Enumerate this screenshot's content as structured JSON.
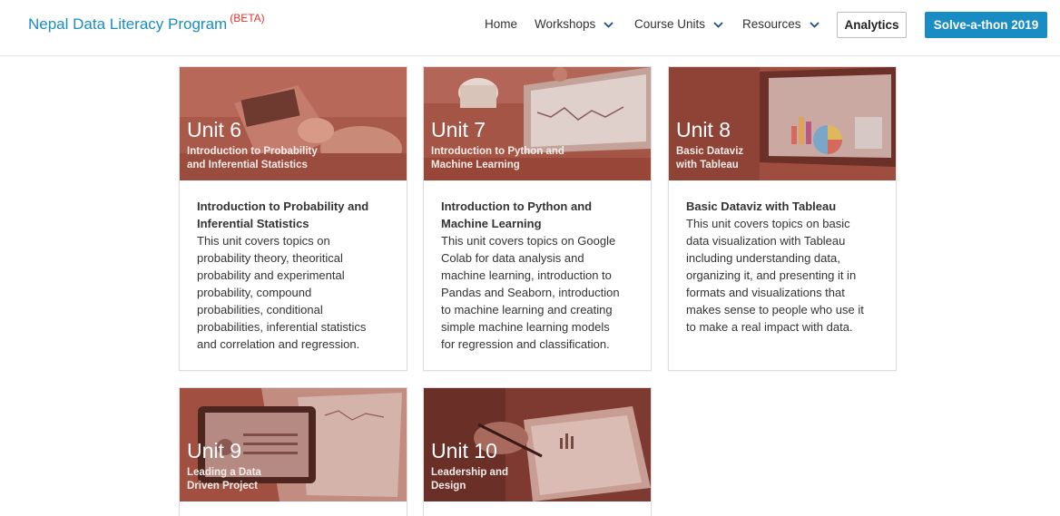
{
  "brand": {
    "name": "Nepal Data Literacy Program",
    "tag": "(BETA)",
    "color": "#1a8cc4",
    "tag_color": "#e3352f"
  },
  "nav": {
    "items": [
      {
        "label": "Home",
        "dropdown": false
      },
      {
        "label": "Workshops",
        "dropdown": true
      },
      {
        "label": "Course Units",
        "dropdown": true
      },
      {
        "label": "Resources",
        "dropdown": true
      }
    ],
    "analytics_label": "Analytics",
    "solve_label": "Solve-a-thon 2019",
    "chevron_icon": "chevron-down-icon"
  },
  "colors": {
    "overlay": "#9c4a3d",
    "accent": "#1a8cc4"
  },
  "cards": [
    {
      "unit": "Unit 6",
      "subtitle_lines": [
        "Introduction to Probability",
        "and Inferential Statistics"
      ],
      "title_lines": [
        "Introduction to Probability and",
        "Inferential Statistics"
      ],
      "desc_lines": [
        "This unit covers topics on",
        "probability theory, theoritical",
        "probability and experimental",
        "probability, compound",
        "probabilities, conditional",
        "probabilities, inferential statistics",
        "and correlation and regression."
      ],
      "image": "office-desk-photo"
    },
    {
      "unit": "Unit 7",
      "subtitle_lines": [
        "Introduction to Python and",
        "Machine Learning"
      ],
      "title_lines": [
        "Introduction to Python and",
        "Machine Learning"
      ],
      "desc_lines": [
        "This unit covers topics on Google",
        "Colab for data analysis and",
        "machine learning, introduction to",
        "Pandas and Seaborn, introduction",
        "to machine learning and creating",
        "simple machine learning models",
        "for regression and classification."
      ],
      "image": "laptop-coffee-photo"
    },
    {
      "unit": "Unit 8",
      "subtitle_lines": [
        "Basic Dataviz",
        "with Tableau"
      ],
      "title_lines": [
        "Basic Dataviz with Tableau"
      ],
      "desc_lines": [
        "This unit covers topics on basic",
        "data visualization with Tableau",
        "including understanding data,",
        "organizing it, and presenting it in",
        "formats and visualizations that",
        "makes sense to people who use it",
        "to make a real impact with data."
      ],
      "image": "laptop-charts-photo"
    },
    {
      "unit": "Unit 9",
      "subtitle_lines": [
        "Leading a Data",
        "Driven Project"
      ],
      "title_lines": [],
      "desc_lines": [],
      "image": "tablet-papers-photo"
    },
    {
      "unit": "Unit 10",
      "subtitle_lines": [
        "Leadership and",
        "Design"
      ],
      "title_lines": [],
      "desc_lines": [],
      "image": "hand-writing-photo"
    }
  ]
}
